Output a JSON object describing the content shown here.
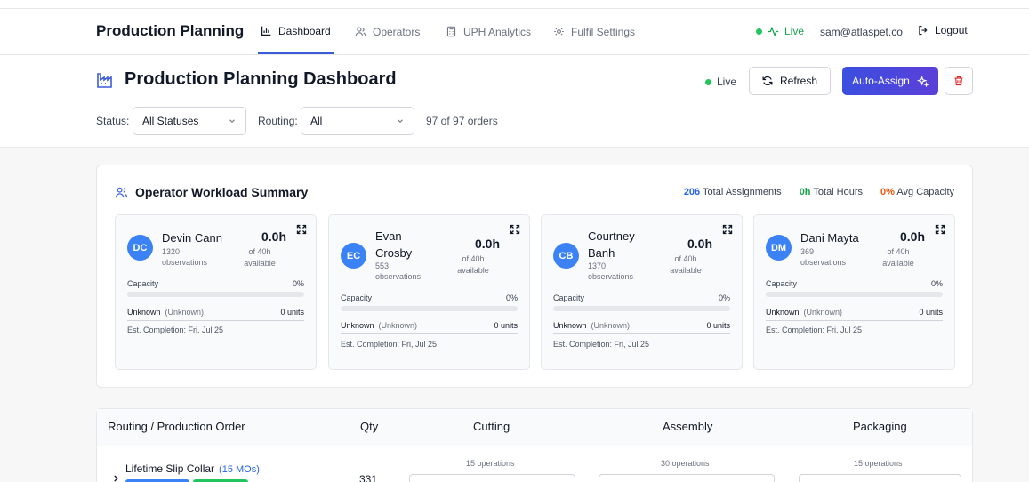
{
  "nav": {
    "brand": "Production Planning",
    "links": [
      {
        "label": "Dashboard",
        "icon": "bar-chart-icon"
      },
      {
        "label": "Operators",
        "icon": "users-icon"
      },
      {
        "label": "UPH Analytics",
        "icon": "calculator-icon"
      },
      {
        "label": "Fulfil Settings",
        "icon": "gear-icon"
      }
    ],
    "live_label": "Live",
    "user_email": "sam@atlaspet.co",
    "logout_label": "Logout"
  },
  "header": {
    "title": "Production Planning Dashboard",
    "live_label": "Live",
    "refresh_label": "Refresh",
    "auto_assign_label": "Auto-Assign",
    "filters": {
      "status_label": "Status:",
      "status_value": "All Statuses",
      "routing_label": "Routing:",
      "routing_value": "All",
      "count_text": "97 of 97 orders"
    }
  },
  "workload": {
    "title": "Operator Workload Summary",
    "total_assignments_value": "206",
    "total_assignments_label": "Total Assignments",
    "total_hours_value": "0h",
    "total_hours_label": "Total Hours",
    "avg_capacity_value": "0%",
    "avg_capacity_label": "Avg Capacity",
    "operators": [
      {
        "initials": "DC",
        "name": "Devin Cann",
        "observations": "1320",
        "obs_label": "observations",
        "hours": "0.0h",
        "of_text": "of 40h",
        "available": "available",
        "capacity_label": "Capacity",
        "capacity_pct": "0%",
        "capacity_fraction": 0,
        "workcenter": "Unknown",
        "workcenter_sub": "(Unknown)",
        "units": "0 units",
        "est_completion": "Est. Completion: Fri, Jul 25"
      },
      {
        "initials": "EC",
        "name": "Evan Crosby",
        "observations": "553",
        "obs_label": "observations",
        "hours": "0.0h",
        "of_text": "of 40h",
        "available": "available",
        "capacity_label": "Capacity",
        "capacity_pct": "0%",
        "capacity_fraction": 0,
        "workcenter": "Unknown",
        "workcenter_sub": "(Unknown)",
        "units": "0 units",
        "est_completion": "Est. Completion: Fri, Jul 25"
      },
      {
        "initials": "CB",
        "name": "Courtney Banh",
        "observations": "1370",
        "obs_label": "observations",
        "hours": "0.0h",
        "of_text": "of 40h",
        "available": "available",
        "capacity_label": "Capacity",
        "capacity_pct": "0%",
        "capacity_fraction": 0,
        "workcenter": "Unknown",
        "workcenter_sub": "(Unknown)",
        "units": "0 units",
        "est_completion": "Est. Completion: Fri, Jul 25"
      },
      {
        "initials": "DM",
        "name": "Dani Mayta",
        "observations": "369",
        "obs_label": "observations",
        "hours": "0.0h",
        "of_text": "of 40h",
        "available": "available",
        "capacity_label": "Capacity",
        "capacity_pct": "0%",
        "capacity_fraction": 0,
        "workcenter": "Unknown",
        "workcenter_sub": "(Unknown)",
        "units": "0 units",
        "est_completion": "Est. Completion: Fri, Jul 25"
      }
    ]
  },
  "table": {
    "headers": [
      "Routing / Production Order",
      "Qty",
      "Cutting",
      "Assembly",
      "Packaging"
    ],
    "rows": [
      {
        "name": "Lifetime Slip Collar",
        "mos": "(15 MOs)",
        "qty": "331",
        "cutting_ops": "15 operations",
        "assembly_ops": "30 operations",
        "packaging_ops": "15 operations"
      }
    ]
  },
  "colors": {
    "accent": "#3b5bdb",
    "live_green": "#22c55e",
    "assignments_blue": "#2563eb",
    "hours_green": "#16a34a",
    "capacity_orange": "#ea580c",
    "avatar_blue": "#3b82f6",
    "delete_red": "#dc2626"
  }
}
